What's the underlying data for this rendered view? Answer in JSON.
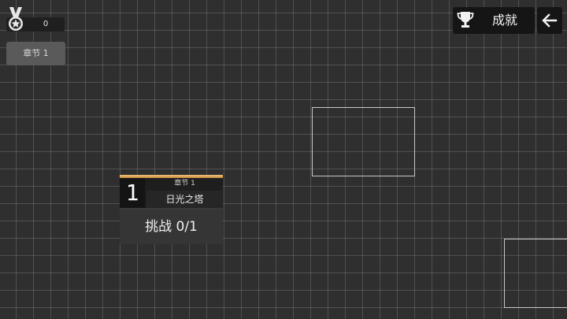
{
  "hud": {
    "medal_count": "0",
    "chapter_button_label": "章节 1"
  },
  "toolbar": {
    "achievements_label": "成就"
  },
  "level_card": {
    "number": "1",
    "chapter_label": "章节 1",
    "title": "日光之塔",
    "challenge_label": "挑战 0/1"
  },
  "icons": {
    "medal": "medal-icon",
    "trophy": "trophy-icon",
    "back": "back-arrow-icon"
  },
  "colors": {
    "background": "#2f2f2f",
    "card_accent": "#e0a85a",
    "panel": "#151515"
  }
}
